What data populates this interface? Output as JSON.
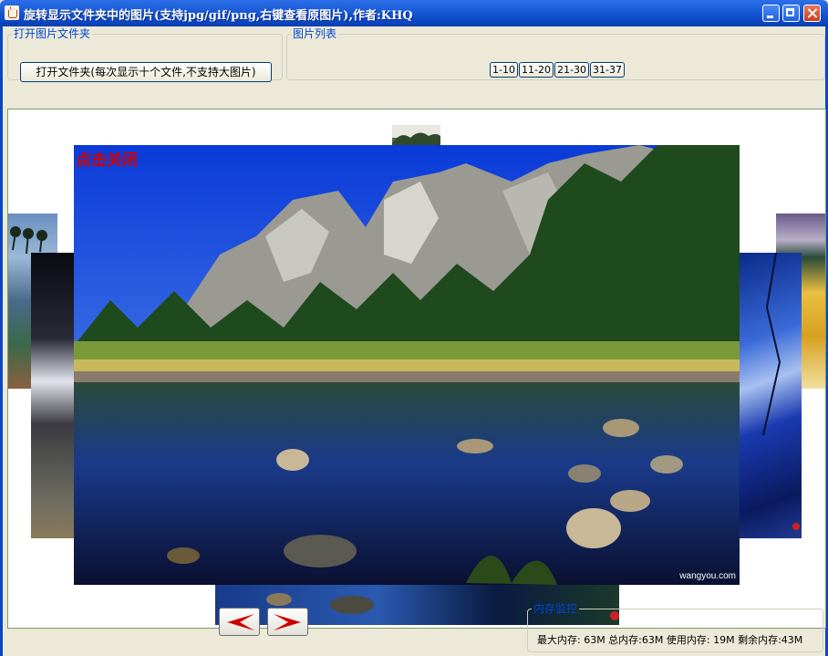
{
  "window": {
    "title": "旋转显示文件夹中的图片(支持jpg/gif/png,右键查看原图片),作者:KHQ",
    "icon": "java-cup-icon"
  },
  "open_group": {
    "legend": "打开图片文件夹",
    "button_label": "打开文件夹(每次显示十个文件,不支持大图片)"
  },
  "list_group": {
    "legend": "图片列表",
    "ranges": [
      "1-10",
      "11-20",
      "21-30",
      "31-37"
    ]
  },
  "viewer": {
    "close_hint": "点击关闭",
    "watermark": "wangyou.com"
  },
  "nav": {
    "prev_icon": "arrow-left-icon",
    "next_icon": "arrow-right-icon",
    "arrow_color": "#cc0000"
  },
  "memory": {
    "legend": "内存监控",
    "text": "最大内存: 63M 总内存:63M 使用内存: 19M 剩余内存:43M"
  },
  "colors": {
    "titlebar": "#0b47c4",
    "legend_text": "#0046d5",
    "close_hint": "#d40000"
  }
}
